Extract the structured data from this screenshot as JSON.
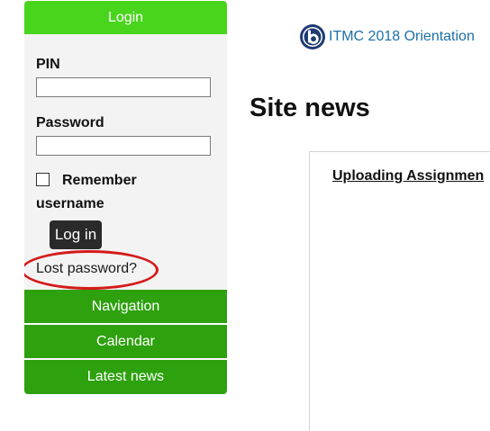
{
  "login_block": {
    "title": "Login",
    "pin_label": "PIN",
    "pin_value": "",
    "password_label": "Password",
    "password_value": "",
    "remember_label": "Remember",
    "remember_label_2": "username",
    "remember_checked": false,
    "login_button": "Log in",
    "lost_password": "Lost password?"
  },
  "nav_blocks": [
    {
      "label": "Navigation"
    },
    {
      "label": "Calendar"
    },
    {
      "label": "Latest news"
    }
  ],
  "course_link": {
    "label": "ITMC 2018 Orientation",
    "icon": "bigbluebutton-icon"
  },
  "site_news": {
    "heading": "Site news",
    "post_title": "Uploading Assignmen"
  },
  "colors": {
    "header_green": "#49d51c",
    "nav_green": "#2ea10f",
    "link_blue": "#1d6fa5",
    "annotation_red": "#d41a1a"
  }
}
